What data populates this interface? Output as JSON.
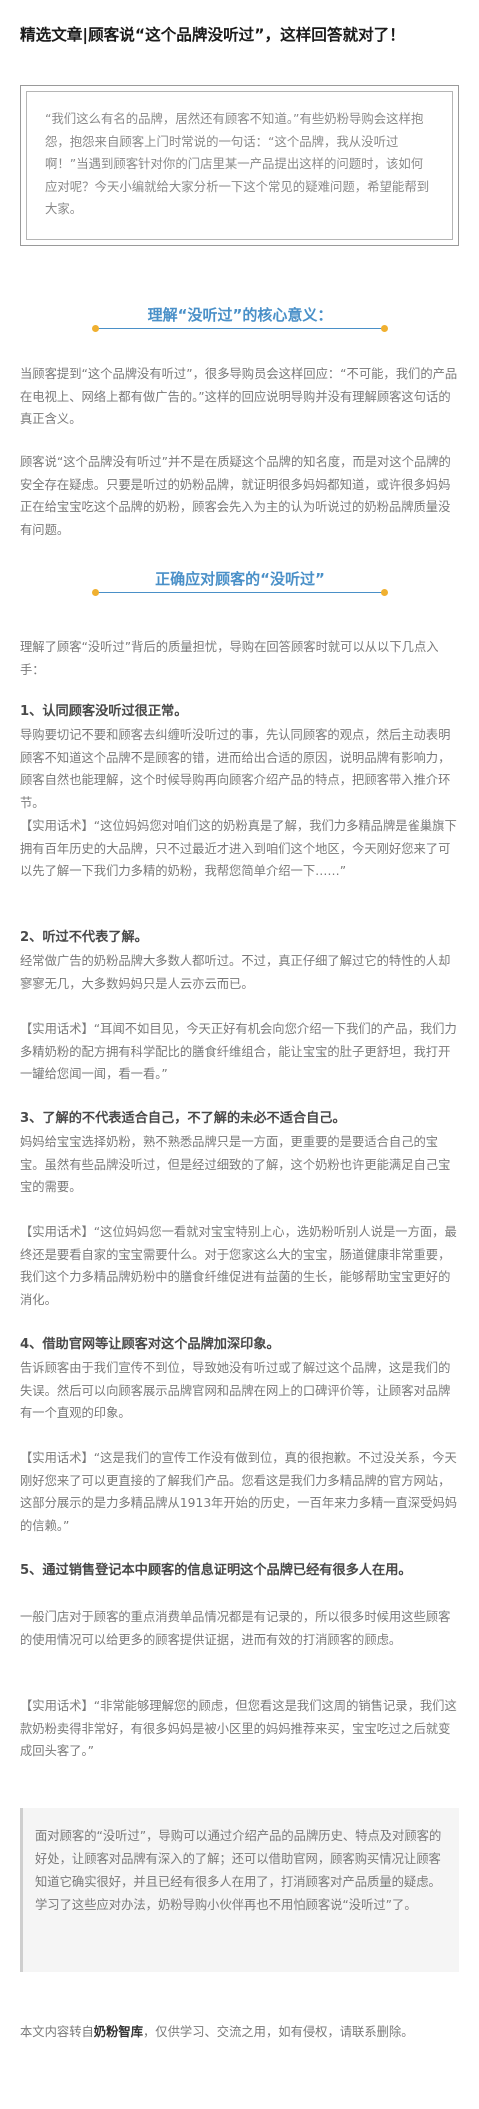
{
  "article": {
    "title": "精选文章|顾客说“这个品牌没听过”，这样回答就对了！",
    "intro": "“我们这么有名的品牌，居然还有顾客不知道。”有些奶粉导购会这样抱怨，抱怨来自顾客上门时常说的一句话：“这个品牌，我从没听过啊！”当遇到顾客针对你的门店里某一产品提出这样的问题时，该如何应对呢？今天小编就给大家分析一下这个常见的疑难问题，希望能帮到大家。"
  },
  "section1": {
    "heading": "理解“没听过”的核心意义：",
    "p1": "当顾客提到“这个品牌没有听过”，很多导购员会这样回应：“不可能，我们的产品在电视上、网络上都有做广告的。”这样的回应说明导购并没有理解顾客这句话的真正含义。",
    "p2": "顾客说“这个品牌没有听过”并不是在质疑这个品牌的知名度，而是对这个品牌的安全存在疑虑。只要是听过的奶粉品牌，就证明很多妈妈都知道，或许很多妈妈正在给宝宝吃这个品牌的奶粉，顾客会先入为主的认为听说过的奶粉品牌质量没有问题。"
  },
  "section2": {
    "heading": "正确应对顾客的“没听过”",
    "lead": "理解了顾客“没听过”背后的质量担忧，导购在回答顾客时就可以从以下几点入手：",
    "points": [
      {
        "title": "1、认同顾客没听过很正常。",
        "body": "导购要切记不要和顾客去纠缠听没听过的事，先认同顾客的观点，然后主动表明顾客不知道这个品牌不是顾客的错，进而给出合适的原因，说明品牌有影响力，顾客自然也能理解，这个时候导购再向顾客介绍产品的特点，把顾客带入推介环节。",
        "script": "【实用话术】“这位妈妈您对咱们这的奶粉真是了解，我们力多精品牌是雀巢旗下拥有百年历史的大品牌，只不过最近才进入到咱们这个地区，今天刚好您来了可以先了解一下我们力多精的奶粉，我帮您简单介绍一下……”"
      },
      {
        "title": "2、听过不代表了解。",
        "body": "经常做广告的奶粉品牌大多数人都听过。不过，真正仔细了解过它的特性的人却寥寥无几，大多数妈妈只是人云亦云而已。",
        "script": "【实用话术】“耳闻不如目见，今天正好有机会向您介绍一下我们的产品，我们力多精奶粉的配方拥有科学配比的膳食纤维组合，能让宝宝的肚子更舒坦，我打开一罐给您闻一闻，看一看。”"
      },
      {
        "title": "3、了解的不代表适合自己，不了解的未必不适合自己。",
        "body": "妈妈给宝宝选择奶粉，熟不熟悉品牌只是一方面，更重要的是要适合自己的宝宝。虽然有些品牌没听过，但是经过细致的了解，这个奶粉也许更能满足自己宝宝的需要。",
        "script": "【实用话术】“这位妈妈您一看就对宝宝特别上心，选奶粉听别人说是一方面，最终还是要看自家的宝宝需要什么。对于您家这么大的宝宝，肠道健康非常重要，我们这个力多精品牌奶粉中的膳食纤维促进有益菌的生长，能够帮助宝宝更好的消化。"
      },
      {
        "title": "4、借助官网等让顾客对这个品牌加深印象。",
        "body": "告诉顾客由于我们宣传不到位，导致她没有听过或了解过这个品牌，这是我们的失误。然后可以向顾客展示品牌官网和品牌在网上的口碑评价等，让顾客对品牌有一个直观的印象。",
        "script": "【实用话术】“这是我们的宣传工作没有做到位，真的很抱歉。不过没关系，今天刚好您来了可以更直接的了解我们产品。您看这是我们力多精品牌的官方网站，这部分展示的是力多精品牌从1913年开始的历史，一百年来力多精一直深受妈妈的信赖。”"
      },
      {
        "title": "5、通过销售登记本中顾客的信息证明这个品牌已经有很多人在用。",
        "body": "一般门店对于顾客的重点消费单品情况都是有记录的，所以很多时候用这些顾客的使用情况可以给更多的顾客提供证据，进而有效的打消顾客的顾虑。",
        "script": "【实用话术】“非常能够理解您的顾虑，但您看这是我们这周的销售记录，我们这款奶粉卖得非常好，有很多妈妈是被小区里的妈妈推荐来买，宝宝吃过之后就变成回头客了。”"
      }
    ]
  },
  "summary": "面对顾客的“没听过”，导购可以通过介绍产品的品牌历史、特点及对顾客的好处，让顾客对品牌有深入的了解；还可以借助官网，顾客购买情况让顾客知道它确实很好，并且已经有很多人在用了，打消顾客对产品质量的疑虑。学习了这些应对办法，奶粉导购小伙伴再也不用怕顾客说“没听过”了。",
  "footer": {
    "prefix": "本文内容转自",
    "source": "奶粉智库",
    "suffix": "，仅供学习、交流之用，如有侵权，请联系删除。"
  },
  "colors": {
    "accent_blue": "#4a90c8",
    "dot_orange": "#f0b030",
    "title_text": "#1a1a1a",
    "body_text": "#7a7a7a"
  }
}
